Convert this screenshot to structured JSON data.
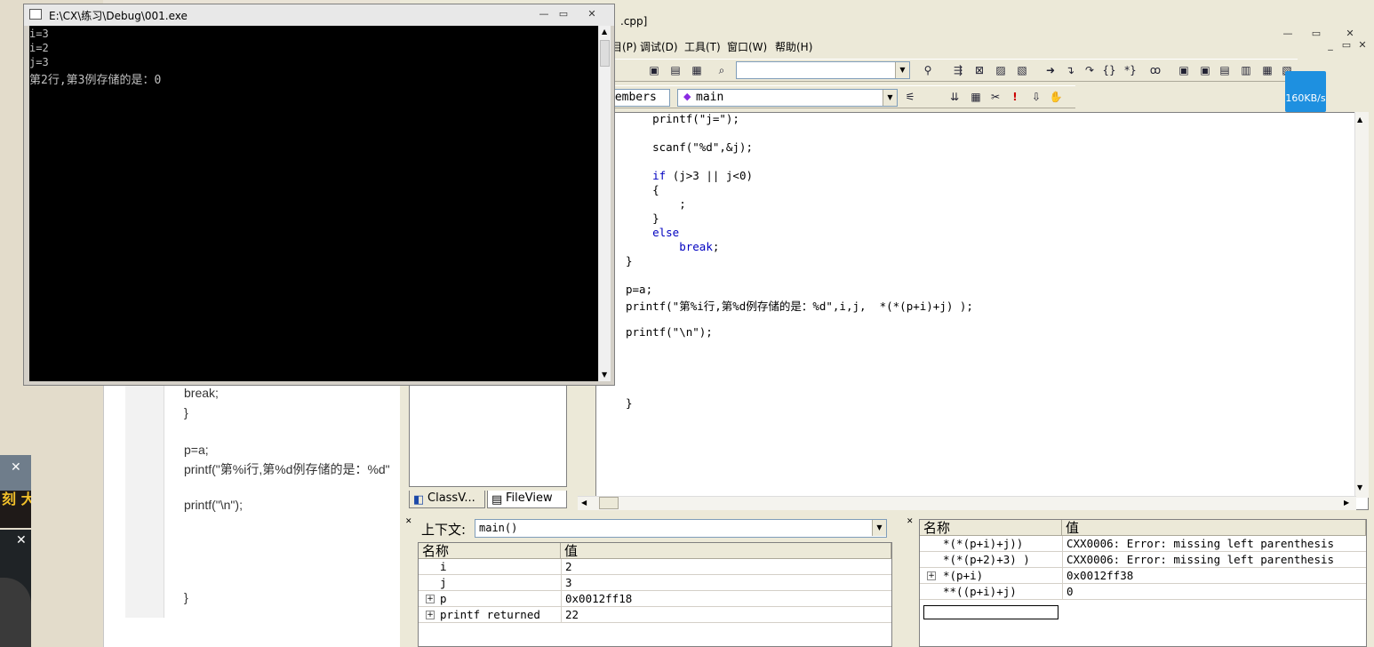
{
  "console": {
    "title": "E:\\CX\\练习\\Debug\\001.exe",
    "lines": [
      "i=3",
      "i=2",
      "j=3",
      "第2行,第3例存储的是：0"
    ]
  },
  "ide": {
    "title_fragment": ".cpp]",
    "menu": [
      "目(P)",
      "调试(D)",
      "工具(T)",
      "窗口(W)",
      "帮助(H)"
    ],
    "members_label": "Members",
    "function_combo": "main",
    "net_speed": "160KB/s",
    "code_lines": [
      "    printf(\"j=\");",
      "",
      "    scanf(\"%d\",&j);",
      "",
      "    if (j>3 || j<0)",
      "    {",
      "        ;",
      "    }",
      "    else",
      "        break;",
      "}",
      "",
      "p=a;",
      "printf(\"第%i行,第%d例存储的是：%d\",i,j,  *(*(p+i)+j) );",
      "",
      "printf(\"\\n\");",
      "",
      "",
      "",
      "",
      "}"
    ],
    "tabs": [
      "ClassV...",
      "FileView"
    ]
  },
  "variables": {
    "context_label": "上下文:",
    "context_value": "main()",
    "col_name": "名称",
    "col_value": "值",
    "rows": [
      {
        "name": "i",
        "value": "2",
        "expandable": false
      },
      {
        "name": "j",
        "value": "3",
        "expandable": false
      },
      {
        "name": "p",
        "value": "0x0012ff18",
        "expandable": true
      },
      {
        "name": "printf returned",
        "value": "22",
        "expandable": true
      }
    ]
  },
  "watch": {
    "col_name": "名称",
    "col_value": "值",
    "rows": [
      {
        "name": "*(*(p+i)+j))",
        "value": "CXX0006: Error: missing left parenthesis",
        "expandable": false
      },
      {
        "name": "*(*(p+2)+3) )",
        "value": "CXX0006: Error: missing left parenthesis",
        "expandable": false
      },
      {
        "name": "*(p+i)",
        "value": "0x0012ff38",
        "expandable": true
      },
      {
        "name": "**((p+i)+j)",
        "value": "0",
        "expandable": false
      }
    ]
  },
  "background_editor": {
    "lines": [
      "break;",
      "}",
      "",
      "p=a;",
      "printf(\"第%i行,第%d例存储的是：%d\"",
      "",
      "printf(\"\\n\");",
      "",
      "",
      "",
      "",
      "}"
    ]
  },
  "ads": {
    "ad1_text": "刻\n大赛"
  }
}
